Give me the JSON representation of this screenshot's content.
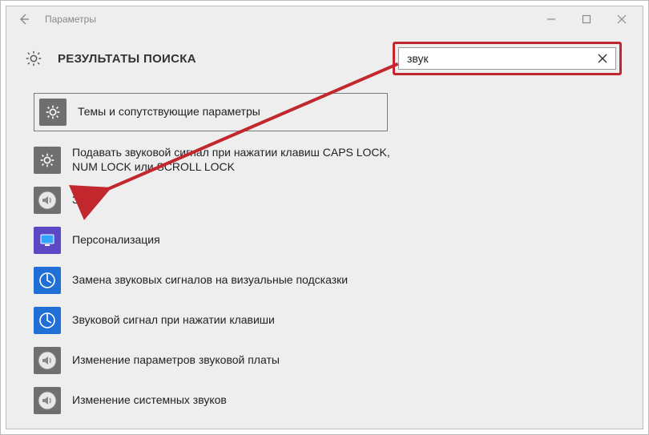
{
  "window": {
    "caption": "Параметры"
  },
  "header": {
    "page_title": "РЕЗУЛЬТАТЫ ПОИСКА"
  },
  "search": {
    "value": "звук",
    "placeholder": ""
  },
  "results": [
    {
      "label": "Темы и сопутствующие параметры"
    },
    {
      "label": "Подавать звуковой сигнал при нажатии клавиш CAPS LOCK, NUM LOCK или SCROLL LOCK"
    },
    {
      "label": "Звук"
    },
    {
      "label": "Персонализация"
    },
    {
      "label": "Замена звуковых сигналов на визуальные подсказки"
    },
    {
      "label": "Звуковой сигнал при нажатии клавиши"
    },
    {
      "label": "Изменение параметров звуковой платы"
    },
    {
      "label": "Изменение системных звуков"
    }
  ],
  "annotation": {
    "arrow_color": "#c1272d"
  }
}
